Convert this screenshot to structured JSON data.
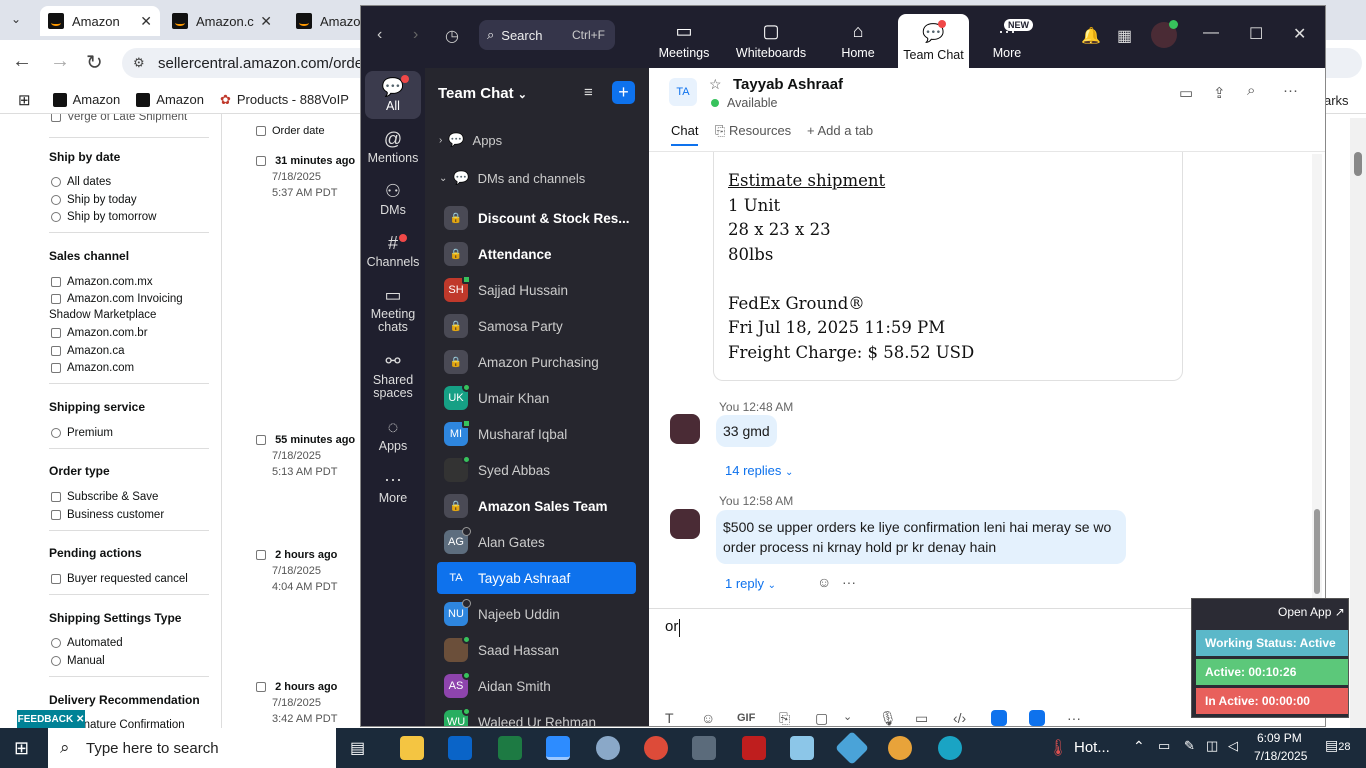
{
  "browser": {
    "tabs": [
      {
        "label": "Amazon",
        "active": true
      },
      {
        "label": "Amazon.c",
        "active": false
      },
      {
        "label": "Amazon",
        "active": false
      }
    ],
    "url": "sellercentral.amazon.com/orders-",
    "bookmarks": [
      "Amazon",
      "Amazon",
      "Products - 888VoIP"
    ],
    "bookmarks_right": "arks"
  },
  "seller": {
    "top_cut": "Verge of Late Shipment",
    "groups": [
      {
        "title": "Ship by date",
        "options": [
          "All dates",
          "Ship by today",
          "Ship by tomorrow"
        ],
        "kind": "radio"
      },
      {
        "title": "Sales channel",
        "options": [
          "Amazon.com.mx",
          "Amazon.com Invoicing",
          "Shadow Marketplace",
          "Amazon.com.br",
          "Amazon.ca",
          "Amazon.com"
        ],
        "kind": "check"
      },
      {
        "title": "Shipping service",
        "options": [
          "Premium"
        ],
        "kind": "radio"
      },
      {
        "title": "Order type",
        "options": [
          "Subscribe & Save",
          "Business customer"
        ],
        "kind": "check"
      },
      {
        "title": "Pending actions",
        "options": [
          "Buyer requested cancel"
        ],
        "kind": "check"
      },
      {
        "title": "Shipping Settings Type",
        "options": [
          "Automated",
          "Manual"
        ],
        "kind": "radio"
      },
      {
        "title": "Delivery Recommendation",
        "options": [
          "Signature Confirmation"
        ],
        "kind": "check"
      }
    ],
    "order_date_header": "Order date",
    "orders": [
      {
        "ago": "31 minutes ago",
        "date": "7/18/2025",
        "time": "5:37 AM PDT"
      },
      {
        "ago": "55 minutes ago",
        "date": "7/18/2025",
        "time": "5:13 AM PDT"
      },
      {
        "ago": "2 hours ago",
        "date": "7/18/2025",
        "time": "4:04 AM PDT"
      },
      {
        "ago": "2 hours ago",
        "date": "7/18/2025",
        "time": "3:42 AM PDT"
      }
    ],
    "feedback": "FEEDBACK"
  },
  "zoom": {
    "search_label": "Search",
    "search_shortcut": "Ctrl+F",
    "nav": [
      {
        "label": "Meetings",
        "icon": "video-icon"
      },
      {
        "label": "Whiteboards",
        "icon": "whiteboard-icon"
      },
      {
        "label": "Home",
        "icon": "home-icon"
      },
      {
        "label": "Team Chat",
        "icon": "chat-icon"
      },
      {
        "label": "More",
        "icon": "more-icon"
      }
    ],
    "new_badge": "NEW",
    "rail": [
      "All",
      "Mentions",
      "DMs",
      "Channels",
      "Meeting chats",
      "Shared spaces",
      "Apps",
      "More"
    ],
    "list_title": "Team Chat",
    "sections": {
      "apps": "Apps",
      "dms": "DMs and channels"
    },
    "chats": [
      {
        "name": "Discount & Stock Res...",
        "initials": "",
        "type": "lock",
        "bold": true
      },
      {
        "name": "Attendance",
        "initials": "",
        "type": "lock",
        "bold": true
      },
      {
        "name": "Sajjad Hussain",
        "initials": "SH",
        "color": "#c0392b",
        "status": "mobile"
      },
      {
        "name": "Samosa Party",
        "initials": "",
        "type": "lock"
      },
      {
        "name": "Amazon Purchasing",
        "initials": "",
        "type": "lock"
      },
      {
        "name": "Umair Khan",
        "initials": "UK",
        "color": "#16a085",
        "status": "online"
      },
      {
        "name": "Musharaf Iqbal",
        "initials": "MI",
        "color": "#2e86de",
        "status": "mobile"
      },
      {
        "name": "Syed Abbas",
        "initials": "",
        "color": "#333",
        "status": "online"
      },
      {
        "name": "Amazon Sales Team",
        "initials": "",
        "type": "lock",
        "bold": true
      },
      {
        "name": "Alan Gates",
        "initials": "AG",
        "color": "#5d6d7e",
        "status": "offline"
      },
      {
        "name": "Tayyab Ashraaf",
        "initials": "TA",
        "color": "#0e72ed",
        "selected": true
      },
      {
        "name": "Najeeb Uddin",
        "initials": "NU",
        "color": "#2e86de",
        "status": "offline"
      },
      {
        "name": "Saad Hassan",
        "initials": "",
        "color": "#6b4f3a",
        "status": "online"
      },
      {
        "name": "Aidan Smith",
        "initials": "AS",
        "color": "#8e44ad",
        "status": "online"
      },
      {
        "name": "Waleed Ur Rehman",
        "initials": "WU",
        "color": "#27ae60",
        "status": "online"
      }
    ],
    "contact": {
      "initials": "TA",
      "name": "Tayyab Ashraaf",
      "status": "Available"
    },
    "tabs": [
      "Chat",
      "Resources",
      "Add a tab"
    ],
    "card_lines": [
      "Estimate shipment",
      "1 Unit",
      "28 x 23 x 23",
      "80lbs",
      "",
      "FedEx Ground®",
      "Fri Jul 18, 2025 11:59 PM",
      "Freight Charge: $ 58.52 USD"
    ],
    "messages": [
      {
        "meta": "You 12:48 AM",
        "text": "33 gmd",
        "replies": "14 replies"
      },
      {
        "meta": "You 12:58 AM",
        "text": "$500 se upper orders ke liye confirmation leni hai meray se wo order process ni krnay hold pr kr denay hain",
        "replies": "1 reply"
      }
    ],
    "compose_text": "or",
    "compose_tools": [
      "format-icon",
      "emoji-icon",
      "gif-icon",
      "file-icon",
      "screenshot-icon",
      "mic-icon",
      "video-msg-icon",
      "code-icon",
      "app1-icon",
      "app2-icon",
      "more-icon"
    ],
    "gif_label": "GIF"
  },
  "widget": {
    "open_app": "Open App ↗",
    "working": "Working Status: Active",
    "active": "Active: 00:10:26",
    "inactive": "In Active: 00:00:00",
    "colors": {
      "working": "#5bb8c9",
      "active": "#5cc87a",
      "inactive": "#e8605c"
    }
  },
  "taskbar": {
    "search_placeholder": "Type here to search",
    "weather": "Hot...",
    "time": "6:09 PM",
    "date": "7/18/2025",
    "notif": "28"
  }
}
